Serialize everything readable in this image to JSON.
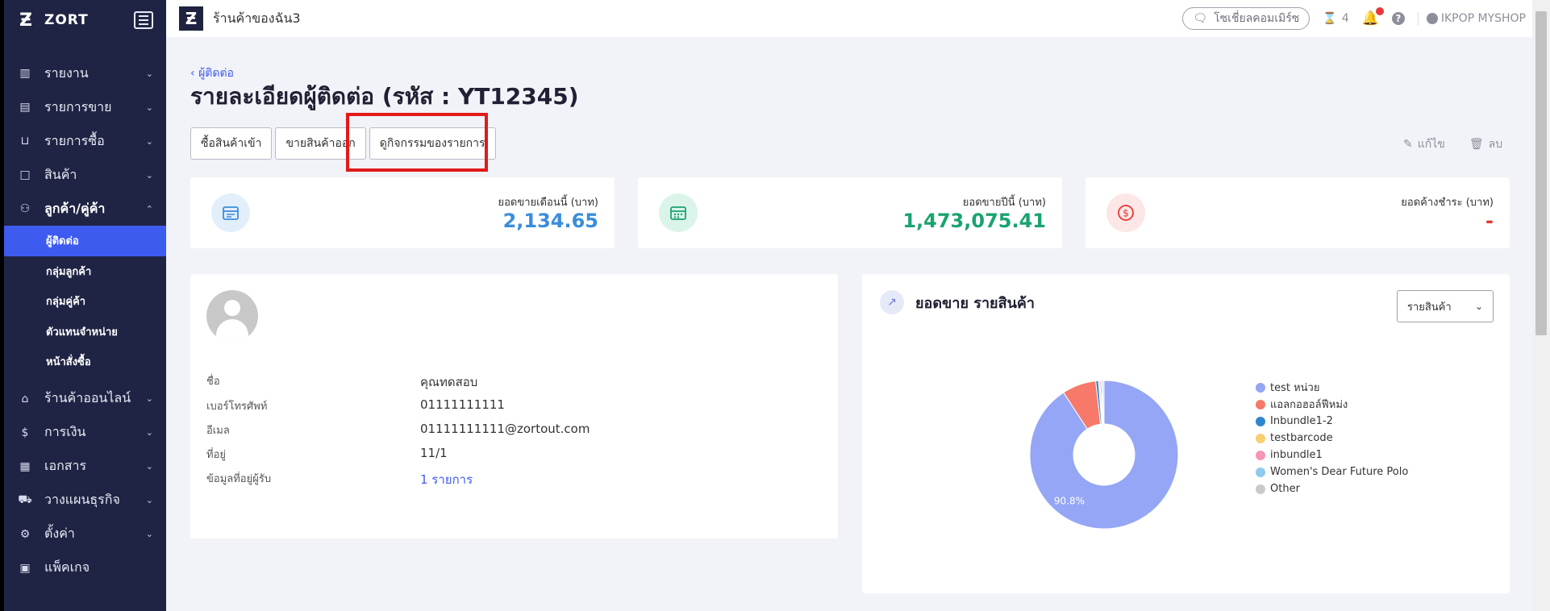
{
  "brand": {
    "name": "ZORT"
  },
  "sidebar": {
    "items": [
      {
        "label": "รายงาน",
        "icon": "bar-chart-icon"
      },
      {
        "label": "รายการขาย",
        "icon": "clipboard-icon"
      },
      {
        "label": "รายการซื้อ",
        "icon": "basket-icon"
      },
      {
        "label": "สินค้า",
        "icon": "box-icon"
      },
      {
        "label": "ลูกค้า/คู่ค้า",
        "icon": "users-icon"
      }
    ],
    "sub_items": [
      {
        "label": "ผู้ติดต่อ",
        "active": true
      },
      {
        "label": "กลุ่มลูกค้า"
      },
      {
        "label": "กลุ่มคู่ค้า"
      },
      {
        "label": "ตัวแทนจำหน่าย"
      },
      {
        "label": "หน้าสั่งซื้อ"
      }
    ],
    "items_after": [
      {
        "label": "ร้านค้าออนไลน์",
        "icon": "store-icon"
      },
      {
        "label": "การเงิน",
        "icon": "dollar-icon"
      },
      {
        "label": "เอกสาร",
        "icon": "document-icon"
      },
      {
        "label": "วางแผนธุรกิจ",
        "icon": "truck-icon"
      },
      {
        "label": "ตั้งค่า",
        "icon": "gear-icon"
      },
      {
        "label": "แพ็คเกจ",
        "icon": "briefcase-icon"
      }
    ]
  },
  "topbar": {
    "shop_name": "ร้านค้าของฉัน3",
    "social_commerce": "โซเชี่ยลคอมเมิร์ซ",
    "hourglass_count": "4",
    "user": "IKPOP MYSHOP"
  },
  "page": {
    "breadcrumb": "ผู้ติดต่อ",
    "title": "รายละเอียดผู้ติดต่อ (รหัส : YT12345)",
    "tabs": [
      "ซื้อสินค้าเข้า",
      "ขายสินค้าออก",
      "ดูกิจกรรมของรายการ"
    ],
    "edit": "แก้ไข",
    "delete": "ลบ"
  },
  "stats": [
    {
      "label": "ยอดขายเดือนนี้ (บาท)",
      "value": "2,134.65",
      "color": "#3a8ddb",
      "icon": "calendar-icon"
    },
    {
      "label": "ยอดขายปีนี้ (บาท)",
      "value": "1,473,075.41",
      "color": "#1aa36f",
      "icon": "calendar-grid-icon"
    },
    {
      "label": "ยอดค้างชำระ (บาท)",
      "value": "-",
      "color": "#e53935",
      "icon": "dollar-circle-icon"
    }
  ],
  "contact": {
    "fields": [
      {
        "label": "ชื่อ",
        "value": "คุณทดสอบ"
      },
      {
        "label": "เบอร์โทรศัพท์",
        "value": "01111111111"
      },
      {
        "label": "อีเมล",
        "value": "01111111111@zortout.com"
      },
      {
        "label": "ที่อยู่",
        "value": "11/1"
      },
      {
        "label": "ข้อมูลที่อยู่ผู้รับ",
        "value": "1 รายการ"
      }
    ]
  },
  "chart_panel": {
    "title": "ยอดขาย รายสินค้า",
    "select_value": "รายสินค้า"
  },
  "chart_data": {
    "type": "pie",
    "donut": true,
    "categories": [
      "test หน่วย",
      "แอลกอฮอล์ฟีหม่ง",
      "Inbundle1-2",
      "testbarcode",
      "inbundle1",
      "Women's Dear Future Polo",
      "Other"
    ],
    "values": [
      90.8,
      7.4,
      0.6,
      0.3,
      0.3,
      0.3,
      0.3
    ],
    "colors": [
      "#94a6f5",
      "#f6796a",
      "#2f86d0",
      "#f7cf72",
      "#f794b9",
      "#8ec9f0",
      "#c9c9c9"
    ],
    "data_labels": [
      "90.8%"
    ],
    "legend_position": "right"
  }
}
